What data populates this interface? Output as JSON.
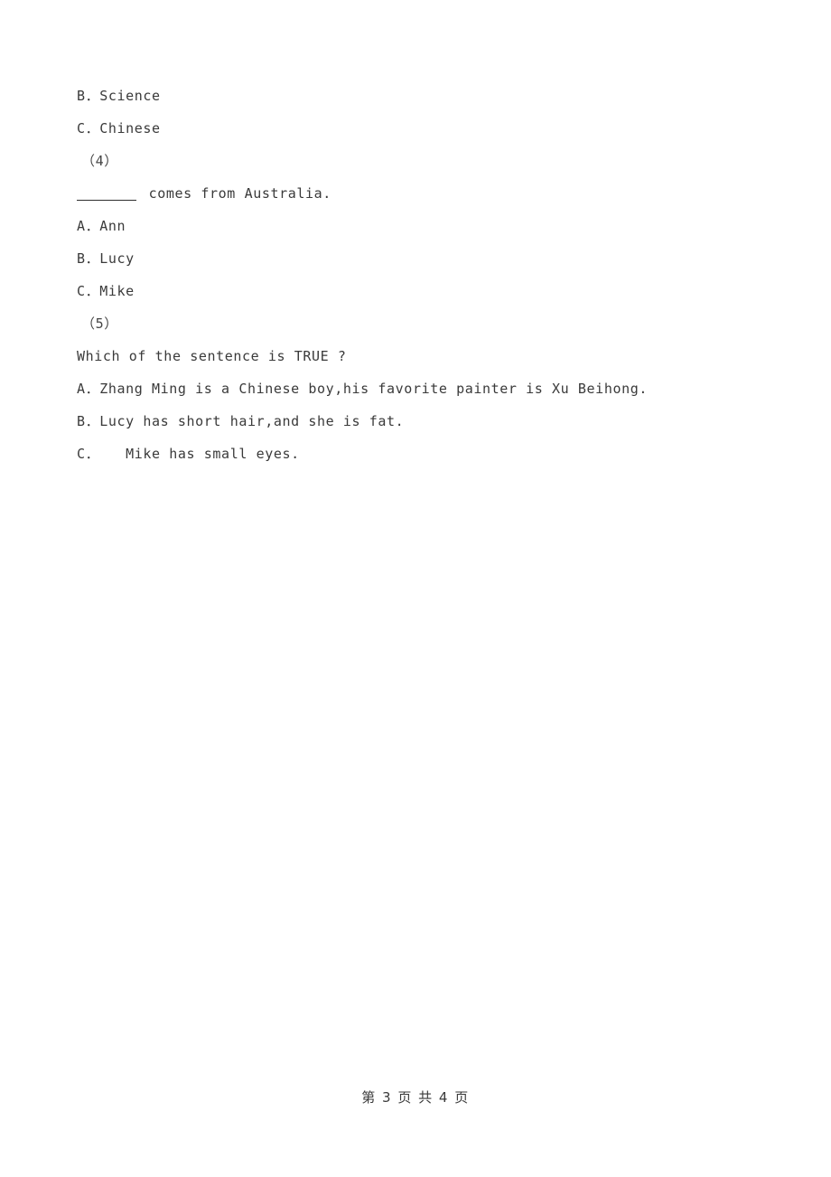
{
  "document": {
    "lines": [
      {
        "id": "q3-option-b",
        "kind": "option",
        "text": "B．Science"
      },
      {
        "id": "q3-option-c",
        "kind": "option",
        "text": "C．Chinese"
      },
      {
        "id": "q4-number",
        "kind": "qnum",
        "text": "（4）"
      },
      {
        "id": "q4-stem",
        "kind": "stem-blank",
        "before": "",
        "after": " comes from Australia."
      },
      {
        "id": "q4-option-a",
        "kind": "option",
        "text": "A．Ann"
      },
      {
        "id": "q4-option-b",
        "kind": "option",
        "text": "B．Lucy"
      },
      {
        "id": "q4-option-c",
        "kind": "option",
        "text": "C．Mike"
      },
      {
        "id": "q5-number",
        "kind": "qnum",
        "text": "（5）"
      },
      {
        "id": "q5-stem",
        "kind": "stem",
        "text": "Which of the sentence is TRUE ?"
      },
      {
        "id": "q5-option-a",
        "kind": "option",
        "text": "A．Zhang Ming is a Chinese boy,his favorite painter is Xu Beihong."
      },
      {
        "id": "q5-option-b",
        "kind": "option",
        "text": "B．Lucy has short hair,and she is fat."
      },
      {
        "id": "q5-option-c",
        "kind": "option",
        "text": "C．   Mike has small eyes."
      }
    ]
  },
  "footer": {
    "text": "第 3 页 共 4 页",
    "current_page": "3",
    "total_pages": "4"
  },
  "colors": {
    "text": "#3a3a3a",
    "background": "#ffffff",
    "rule": "#2e2e2e"
  }
}
